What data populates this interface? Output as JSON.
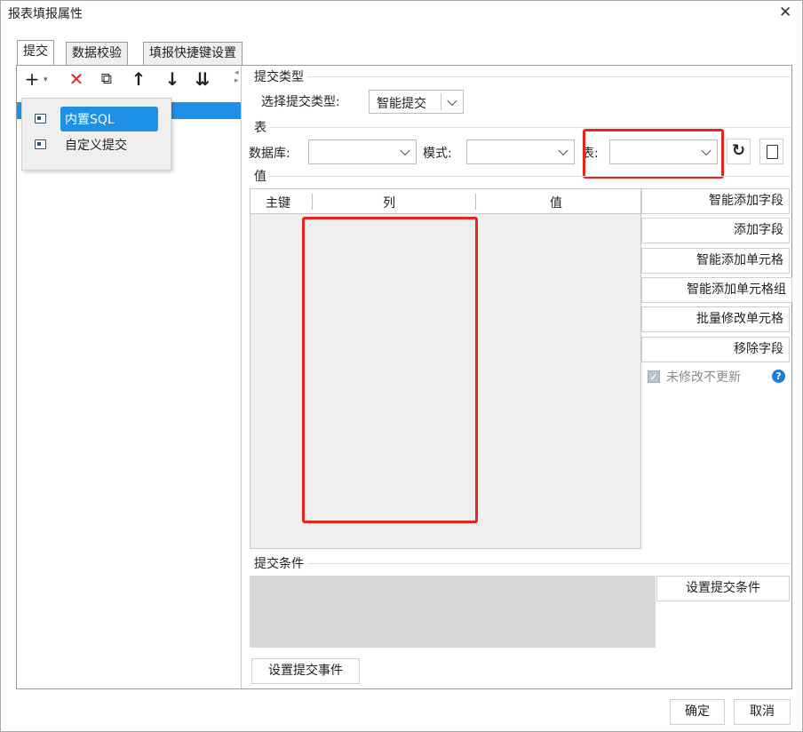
{
  "window": {
    "title": "报表填报属性",
    "close_symbol": "✕"
  },
  "tabs": [
    {
      "label": "提交",
      "active": true
    },
    {
      "label": "数据校验",
      "active": false
    },
    {
      "label": "填报快捷键设置",
      "active": false
    }
  ],
  "toolbar": {
    "add": "+",
    "add_caret": "▾",
    "delete": "✕",
    "copy": "⧉",
    "up": "↑",
    "down": "↓",
    "sort": "⇊"
  },
  "dropdown_menu": {
    "items": [
      {
        "label": "内置SQL",
        "selected": true
      },
      {
        "label": "自定义提交",
        "selected": false
      }
    ]
  },
  "submit_type": {
    "section_label": "提交类型",
    "select_label": "选择提交类型:",
    "select_value": "智能提交"
  },
  "table_section": {
    "section_label": "表",
    "database_label": "数据库:",
    "database_value": "",
    "schema_label": "模式:",
    "schema_value": "",
    "table_label": "表:",
    "table_value": ""
  },
  "values_section": {
    "section_label": "值",
    "columns": [
      "主键",
      "列",
      "值"
    ],
    "rows": []
  },
  "side_buttons": [
    "智能添加字段",
    "添加字段",
    "智能添加单元格",
    "智能添加单元格组",
    "批量修改单元格",
    "移除字段"
  ],
  "no_update_checkbox": {
    "label": "未修改不更新",
    "checked": true
  },
  "submit_condition": {
    "section_label": "提交条件",
    "button": "设置提交条件"
  },
  "submit_event_button": "设置提交事件",
  "footer": {
    "ok": "确定",
    "cancel": "取消"
  },
  "colors": {
    "highlight_box": "#e8241b",
    "selection": "#1e90e6",
    "help_icon": "#1a7be0",
    "title_bg": "#ffffff",
    "panel_gray": "#d7d7d7"
  }
}
